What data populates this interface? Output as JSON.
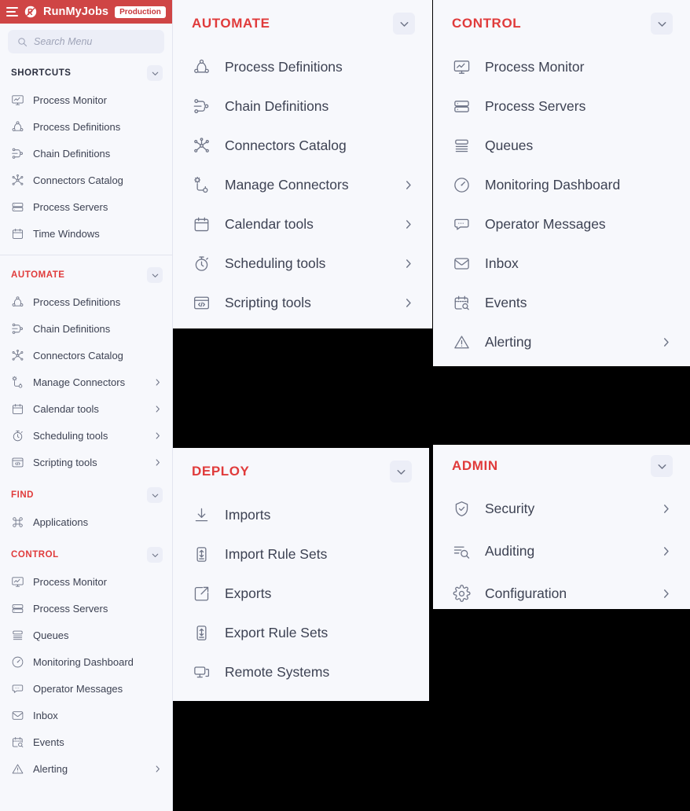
{
  "header": {
    "menu_icon": "hamburger-icon",
    "logo_icon": "runmyjobs-logo-icon",
    "brand": "RunMyJobs",
    "environment_badge": "Production",
    "bg_color": "#cf4545"
  },
  "search": {
    "icon": "search-icon",
    "value": "",
    "placeholder": "Search Menu"
  },
  "accent_color": "#e03b3b",
  "sidebar": {
    "sections": [
      {
        "title": "SHORTCUTS",
        "title_style": "dark",
        "collapse_icon": "chevron-down-icon",
        "items": [
          {
            "label": "Process Monitor",
            "icon": "monitor-icon",
            "has_submenu": false
          },
          {
            "label": "Process Definitions",
            "icon": "process-definitions-icon",
            "has_submenu": false
          },
          {
            "label": "Chain Definitions",
            "icon": "chain-definitions-icon",
            "has_submenu": false
          },
          {
            "label": "Connectors Catalog",
            "icon": "connectors-catalog-icon",
            "has_submenu": false
          },
          {
            "label": "Process Servers",
            "icon": "server-icon",
            "has_submenu": false
          },
          {
            "label": "Time Windows",
            "icon": "calendar-icon",
            "has_submenu": false
          }
        ]
      },
      {
        "title": "AUTOMATE",
        "title_style": "red",
        "collapse_icon": "chevron-down-icon",
        "items": [
          {
            "label": "Process Definitions",
            "icon": "process-definitions-icon",
            "has_submenu": false
          },
          {
            "label": "Chain Definitions",
            "icon": "chain-definitions-icon",
            "has_submenu": false
          },
          {
            "label": "Connectors Catalog",
            "icon": "connectors-catalog-icon",
            "has_submenu": false
          },
          {
            "label": "Manage Connectors",
            "icon": "manage-connectors-icon",
            "has_submenu": true
          },
          {
            "label": "Calendar tools",
            "icon": "calendar-icon",
            "has_submenu": true
          },
          {
            "label": "Scheduling tools",
            "icon": "stopwatch-icon",
            "has_submenu": true
          },
          {
            "label": "Scripting tools",
            "icon": "code-window-icon",
            "has_submenu": true
          }
        ]
      },
      {
        "title": "FIND",
        "title_style": "red",
        "collapse_icon": "chevron-down-icon",
        "items": [
          {
            "label": "Applications",
            "icon": "applications-icon",
            "has_submenu": false
          }
        ]
      },
      {
        "title": "CONTROL",
        "title_style": "red",
        "collapse_icon": "chevron-down-icon",
        "items": [
          {
            "label": "Process Monitor",
            "icon": "monitor-icon",
            "has_submenu": false
          },
          {
            "label": "Process Servers",
            "icon": "server-icon",
            "has_submenu": false
          },
          {
            "label": "Queues",
            "icon": "queues-icon",
            "has_submenu": false
          },
          {
            "label": "Monitoring Dashboard",
            "icon": "gauge-icon",
            "has_submenu": false
          },
          {
            "label": "Operator Messages",
            "icon": "message-icon",
            "has_submenu": false
          },
          {
            "label": "Inbox",
            "icon": "inbox-icon",
            "has_submenu": false
          },
          {
            "label": "Events",
            "icon": "events-icon",
            "has_submenu": false
          },
          {
            "label": "Alerting",
            "icon": "warning-icon",
            "has_submenu": true
          }
        ]
      }
    ]
  },
  "panels": [
    {
      "id": "automate",
      "title": "AUTOMATE",
      "collapse_icon": "chevron-down-icon",
      "items": [
        {
          "label": "Process Definitions",
          "icon": "process-definitions-icon",
          "has_submenu": false
        },
        {
          "label": "Chain Definitions",
          "icon": "chain-definitions-icon",
          "has_submenu": false
        },
        {
          "label": "Connectors Catalog",
          "icon": "connectors-catalog-icon",
          "has_submenu": false
        },
        {
          "label": "Manage Connectors",
          "icon": "manage-connectors-icon",
          "has_submenu": true
        },
        {
          "label": "Calendar tools",
          "icon": "calendar-icon",
          "has_submenu": true
        },
        {
          "label": "Scheduling tools",
          "icon": "stopwatch-icon",
          "has_submenu": true
        },
        {
          "label": "Scripting tools",
          "icon": "code-window-icon",
          "has_submenu": true
        }
      ]
    },
    {
      "id": "control",
      "title": "CONTROL",
      "collapse_icon": "chevron-down-icon",
      "items": [
        {
          "label": "Process Monitor",
          "icon": "monitor-icon",
          "has_submenu": false
        },
        {
          "label": "Process Servers",
          "icon": "server-icon",
          "has_submenu": false
        },
        {
          "label": "Queues",
          "icon": "queues-icon",
          "has_submenu": false
        },
        {
          "label": "Monitoring Dashboard",
          "icon": "gauge-icon",
          "has_submenu": false
        },
        {
          "label": "Operator Messages",
          "icon": "message-icon",
          "has_submenu": false
        },
        {
          "label": "Inbox",
          "icon": "inbox-icon",
          "has_submenu": false
        },
        {
          "label": "Events",
          "icon": "events-icon",
          "has_submenu": false
        },
        {
          "label": "Alerting",
          "icon": "warning-icon",
          "has_submenu": true
        }
      ]
    },
    {
      "id": "deploy",
      "title": "DEPLOY",
      "collapse_icon": "chevron-down-icon",
      "items": [
        {
          "label": "Imports",
          "icon": "import-icon",
          "has_submenu": false
        },
        {
          "label": "Import Rule Sets",
          "icon": "import-rule-sets-icon",
          "has_submenu": false
        },
        {
          "label": "Exports",
          "icon": "export-icon",
          "has_submenu": false
        },
        {
          "label": "Export Rule Sets",
          "icon": "export-rule-sets-icon",
          "has_submenu": false
        },
        {
          "label": "Remote Systems",
          "icon": "remote-systems-icon",
          "has_submenu": false
        }
      ]
    },
    {
      "id": "admin",
      "title": "ADMIN",
      "collapse_icon": "chevron-down-icon",
      "items": [
        {
          "label": "Security",
          "icon": "shield-check-icon",
          "has_submenu": true
        },
        {
          "label": "Auditing",
          "icon": "auditing-icon",
          "has_submenu": true
        },
        {
          "label": "Configuration",
          "icon": "gear-icon",
          "has_submenu": true
        }
      ]
    }
  ]
}
